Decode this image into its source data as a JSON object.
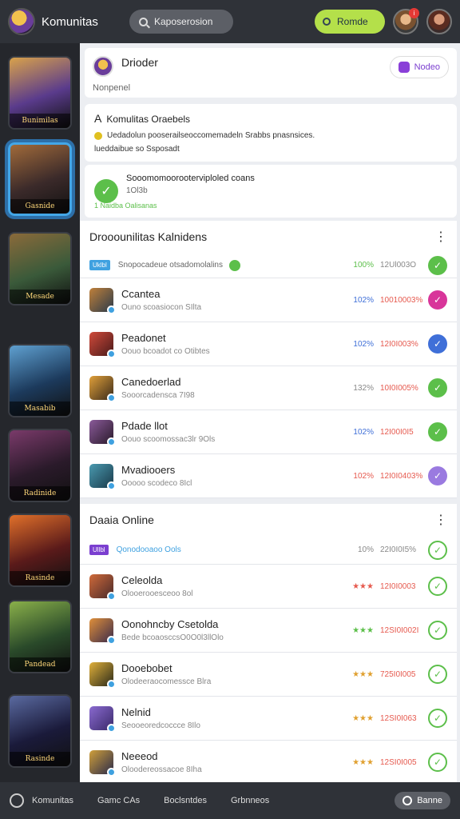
{
  "header": {
    "app_title": "Komunitas",
    "search_placeholder": "Kaposerosion",
    "action_label": "Romde",
    "notif_badge": "i"
  },
  "rail": {
    "items": [
      {
        "label": "Bunimilas",
        "colors": [
          "#5a3b8c",
          "#d9a24a"
        ]
      },
      {
        "label": "Gasnide",
        "colors": [
          "#3b2a2a",
          "#a06a3a"
        ]
      },
      {
        "label": "Mesade",
        "colors": [
          "#3a5a3a",
          "#8a6a3a"
        ]
      },
      {
        "label": "Masabib",
        "colors": [
          "#1c3a5c",
          "#5fa0d0"
        ]
      },
      {
        "label": "Radinide",
        "colors": [
          "#2a1a2a",
          "#7a3a6a"
        ]
      },
      {
        "label": "Rasinde",
        "colors": [
          "#5a1a1a",
          "#e0702a"
        ]
      },
      {
        "label": "Pandead",
        "colors": [
          "#2a4a2a",
          "#8ab04a"
        ]
      },
      {
        "label": "Rasinde",
        "colors": [
          "#1a1a3a",
          "#5a6aa0"
        ]
      }
    ]
  },
  "profile": {
    "title": "Drioder",
    "subtitle": "Nonpenel",
    "button": "Nodeo"
  },
  "info": {
    "heading": "Komulitas Oraebels",
    "line1": "Uedadolun  pooserailseoccomemadeln Srabbs pnasnsices.",
    "line2": "lueddaibue so Ssposadt"
  },
  "status": {
    "title": "Sooomomoorooterviploled coans",
    "sub": "1Ol3b",
    "link": "1 Naidba Oalisanas"
  },
  "section1": {
    "title": "Drooounilitas Kalnidens",
    "tag": "Uklbl",
    "sub": "Snopocadeue otsadomolalins",
    "pct": "100%",
    "val": "12Ul003O",
    "rows": [
      {
        "name": "Ccantea",
        "sub": "Ouno scoasiocon SIlta",
        "pct": "102%",
        "val": "10010003%",
        "pct_color": "#3f6fd8",
        "btn": "#d8359a",
        "thumb": [
          "#2a3a4a",
          "#c0803a"
        ]
      },
      {
        "name": "Peadonet",
        "sub": "Oouo bcoadot co Otibtes",
        "pct": "102%",
        "val": "12I0I003%",
        "pct_color": "#3f6fd8",
        "btn": "#3f6fd8",
        "thumb": [
          "#4a1a1a",
          "#d04a3a"
        ]
      },
      {
        "name": "Canedoerlad",
        "sub": "Sooorcadensca 7I98",
        "pct": "132%",
        "val": "10I0I005%",
        "pct_color": "#888888",
        "btn": "#5cbf4a",
        "thumb": [
          "#3a2a1a",
          "#e0a03a"
        ]
      },
      {
        "name": "Pdade llot",
        "sub": "Oouo scoomossac3lr 9Ols",
        "pct": "102%",
        "val": "12I00I0I5",
        "pct_color": "#3f6fd8",
        "btn": "#5cbf4a",
        "thumb": [
          "#2a1a2a",
          "#8a5a9a"
        ]
      },
      {
        "name": "Mvadiooers",
        "sub": "Ooooo scodeco 8Icl",
        "pct": "102%",
        "val": "12I0I0403%",
        "pct_color": "#e65a4f",
        "btn": "#9a7ae0",
        "thumb": [
          "#1a3a4a",
          "#4a9ab0"
        ]
      }
    ]
  },
  "section2": {
    "title": "Daaia Online",
    "tag": "Ullbl",
    "sub": "Qonodooaoo Ools",
    "pct": "10%",
    "val": "22I0I0I5%",
    "rows": [
      {
        "name": "Celeolda",
        "sub": "Olooerooesceoo 8ol",
        "pct": "★★★",
        "val": "12I0I0003",
        "pct_color": "#e65a4f",
        "thumb": [
          "#4a2a2a",
          "#d06a3a"
        ]
      },
      {
        "name": "Oonohncby Csetolda",
        "sub": "Bede bcoaosccsO0O0l3llOlo",
        "pct": "★★★",
        "val": "12SI0I002I",
        "pct_color": "#5cbf4a",
        "thumb": [
          "#3a2a4a",
          "#e0903a"
        ]
      },
      {
        "name": "Dooebobet",
        "sub": "Olodeeraocomessce Blra",
        "pct": "★★★",
        "val": "725I0I005",
        "pct_color": "#e0a030",
        "thumb": [
          "#2a2a1a",
          "#e0b03a"
        ]
      },
      {
        "name": "Nelnid",
        "sub": "Seooeoredcoccce 8Ilo",
        "pct": "★★★",
        "val": "12SI0I063",
        "pct_color": "#e0a030",
        "thumb": [
          "#3a2a6a",
          "#8a6ad0"
        ]
      },
      {
        "name": "Neeeod",
        "sub": "Oloodereossacoe 8Iha",
        "pct": "★★★",
        "val": "12SI0I005",
        "pct_color": "#e0a030",
        "thumb": [
          "#2a2a4a",
          "#d0a03a"
        ]
      }
    ]
  },
  "bottom": {
    "item1": "Komunitas",
    "item2": "Gamc CAs",
    "item3": "Boclsntdes",
    "item4": "Grbnneos",
    "button": "Banne"
  },
  "colors": {
    "accent": "#43a7e8",
    "positive": "#5cbf4a",
    "action": "#b4e04a"
  }
}
